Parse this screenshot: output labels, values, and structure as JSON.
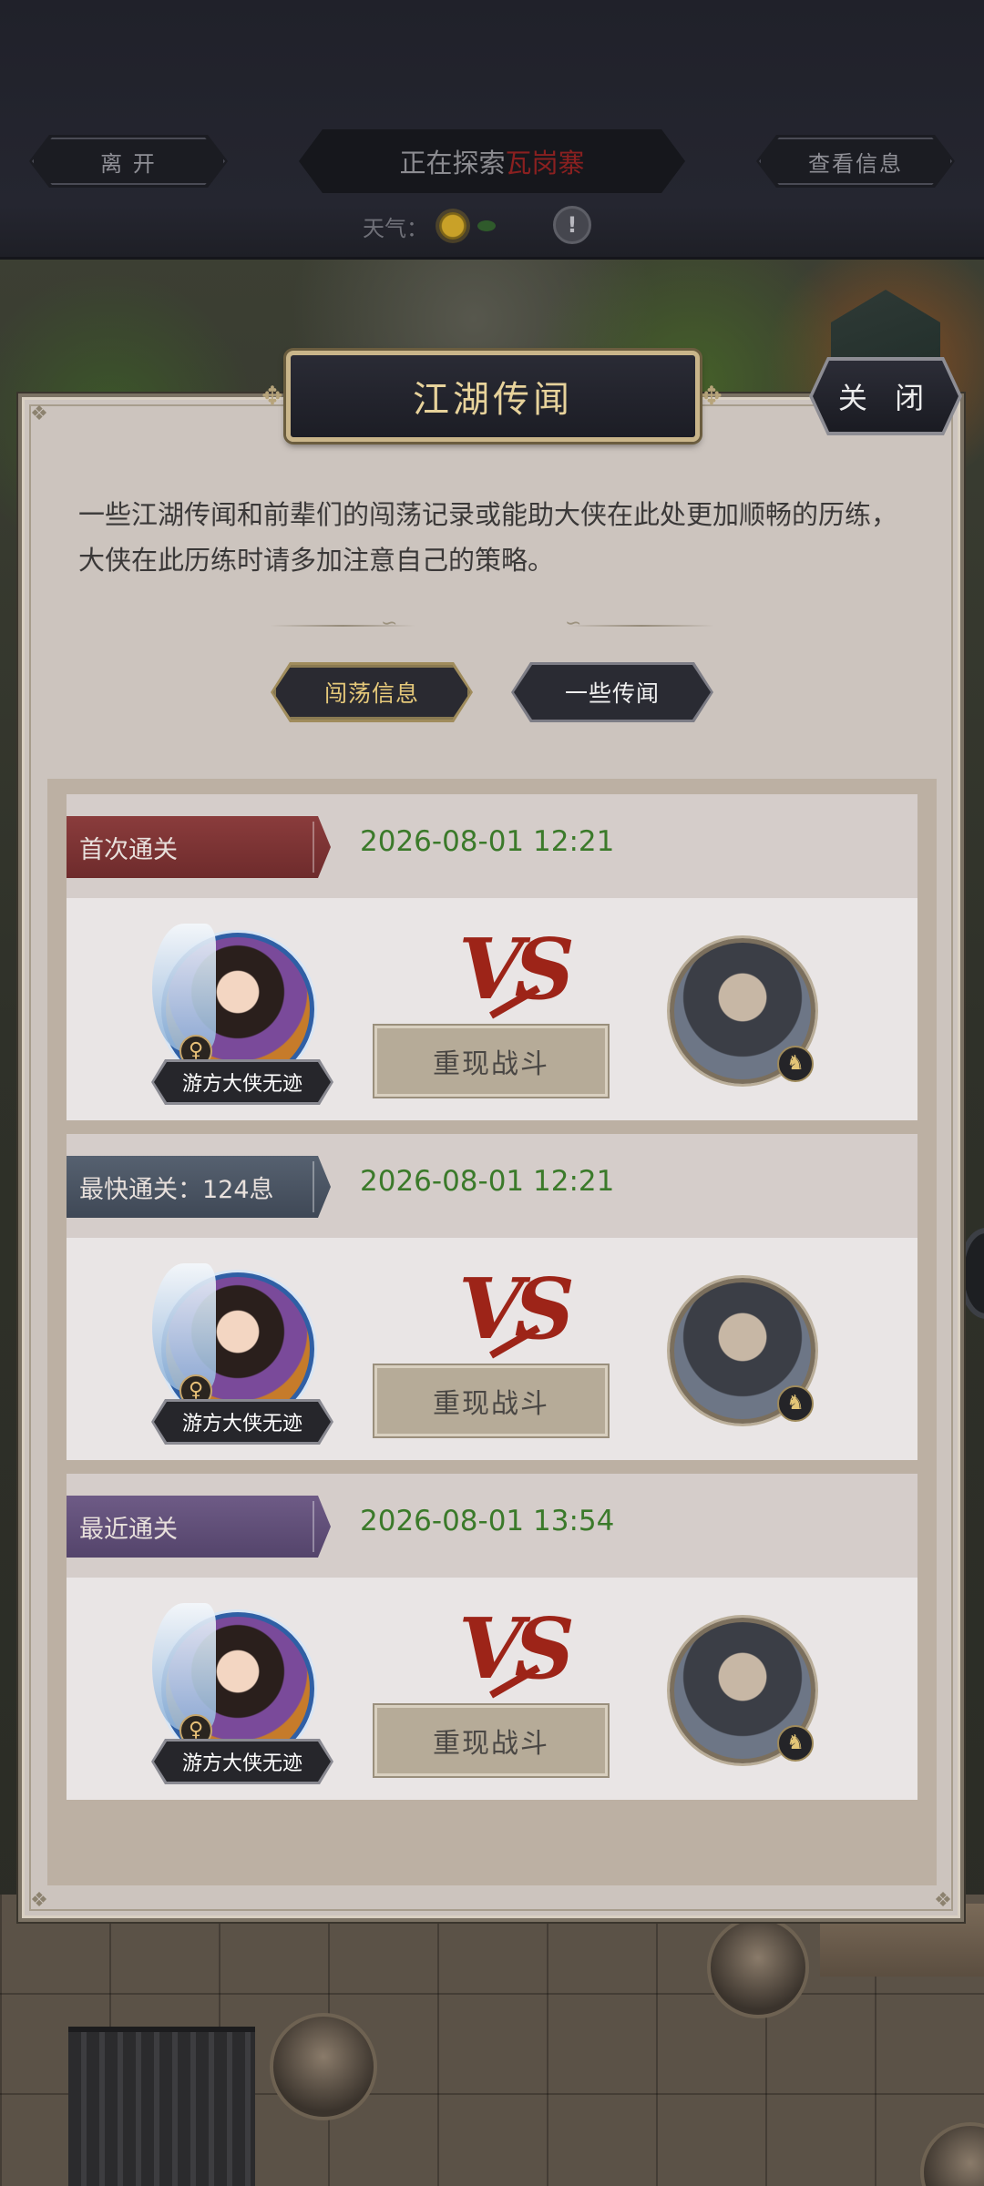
{
  "topbar": {
    "leave_label": "离  开",
    "explore_prefix": "正在探索",
    "explore_place": "瓦岗寨",
    "info_label": "查看信息",
    "weather_label": "天气：",
    "weather_icon": "sun-icon",
    "alert_icon_glyph": "!"
  },
  "modal": {
    "title": "江湖传闻",
    "close_label": "关 闭",
    "description": "一些江湖传闻和前辈们的闯荡记录或能助大侠在此处更加顺畅的历练，大侠在此历练时请多加注意自己的策略。",
    "tabs": [
      {
        "label": "闯荡信息",
        "active": true
      },
      {
        "label": "一些传闻",
        "active": false
      }
    ]
  },
  "records": [
    {
      "badge": "首次通关",
      "badge_color": "#7a3333",
      "time": "2026-08-01 12:21",
      "hero_name": "游方大侠无迹",
      "vs": "VS",
      "replay_label": "重现战斗"
    },
    {
      "badge": "最快通关：124息",
      "badge_color": "#4b5563",
      "time": "2026-08-01 12:21",
      "hero_name": "游方大侠无迹",
      "vs": "VS",
      "replay_label": "重现战斗"
    },
    {
      "badge": "最近通关",
      "badge_color": "#5e4d77",
      "time": "2026-08-01 13:54",
      "hero_name": "游方大侠无迹",
      "vs": "VS",
      "replay_label": "重现战斗"
    }
  ],
  "colors": {
    "accent_gold": "#e6c97a",
    "time_green": "#3b7a2a",
    "vs_red": "#9d2418",
    "place_red": "#8a2020"
  }
}
